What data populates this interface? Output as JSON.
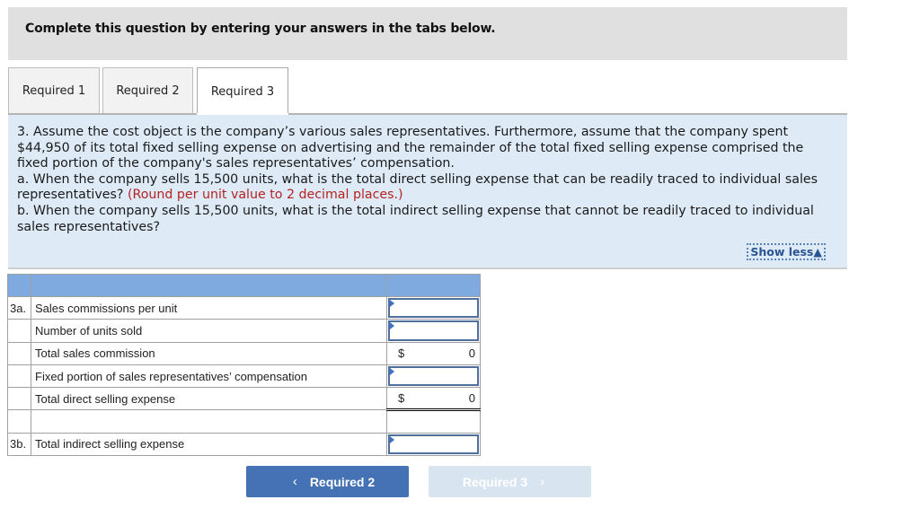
{
  "instructions": "Complete this question by entering your answers in the tabs below.",
  "tabs": [
    {
      "label": "Required 1",
      "active": false
    },
    {
      "label": "Required 2",
      "active": false
    },
    {
      "label": "Required 3",
      "active": true
    }
  ],
  "question": {
    "line1": "3. Assume the cost object is the company’s various sales representatives. Furthermore, assume that the company spent $44,950 of its total fixed selling expense on advertising and the remainder of the total fixed selling expense comprised the fixed portion of the company's sales representatives’ compensation.",
    "part_a": "a. When the company sells 15,500 units, what is the total direct selling expense that can be readily traced to individual sales representatives?",
    "part_a_note": "(Round per unit value to 2 decimal places.)",
    "part_b": "b. When the company sells 15,500 units, what is the total indirect selling expense that cannot be readily traced to individual sales representatives?",
    "show_less": "Show less▲"
  },
  "table": {
    "rows": [
      {
        "label": "3a.",
        "desc": "Sales commissions per unit",
        "type": "input",
        "value": ""
      },
      {
        "label": "",
        "desc": "Number of units sold",
        "type": "input",
        "value": ""
      },
      {
        "label": "",
        "desc": "Total sales commission",
        "type": "computed",
        "currency": "$",
        "value": "0"
      },
      {
        "label": "",
        "desc": "Fixed portion of sales representatives’ compensation",
        "type": "input",
        "value": ""
      },
      {
        "label": "",
        "desc": "Total direct selling expense",
        "type": "computed",
        "currency": "$",
        "value": "0"
      },
      {
        "label": "",
        "desc": "",
        "type": "blank",
        "value": ""
      },
      {
        "label": "3b.",
        "desc": "Total indirect selling expense",
        "type": "input",
        "value": ""
      }
    ]
  },
  "nav": {
    "prev_label": "Required 2",
    "next_label": "Required 3",
    "prev_icon": "‹",
    "next_icon": "›"
  }
}
